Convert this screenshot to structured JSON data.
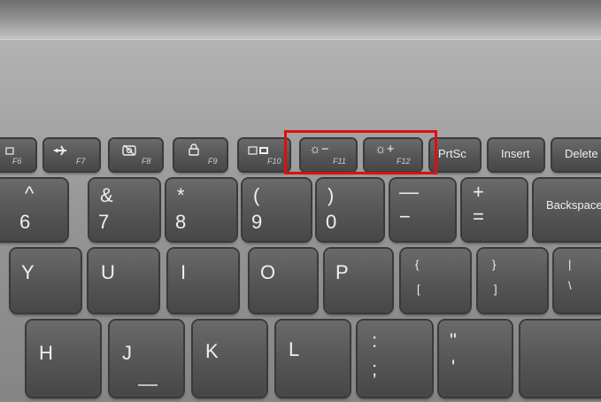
{
  "function_row": {
    "f6": {
      "fn": "F6",
      "icon": "display-icon"
    },
    "f7": {
      "fn": "F7",
      "icon": "airplane-icon"
    },
    "f8": {
      "fn": "F8",
      "icon": "camera-off-icon"
    },
    "f9": {
      "fn": "F9",
      "icon": "lock-icon"
    },
    "f10": {
      "fn": "F10",
      "icon": "dual-display-icon"
    },
    "f11": {
      "fn": "F11",
      "symbol": "☼−",
      "icon": "brightness-down-icon"
    },
    "f12": {
      "fn": "F12",
      "symbol": "☼+",
      "icon": "brightness-up-icon"
    },
    "prtsc": "PrtSc",
    "insert": "Insert",
    "delete": "Delete"
  },
  "number_row": [
    {
      "top": "^",
      "bottom": "6"
    },
    {
      "top": "&",
      "bottom": "7"
    },
    {
      "top": "*",
      "bottom": "8"
    },
    {
      "top": "(",
      "bottom": "9"
    },
    {
      "top": ")",
      "bottom": "0"
    },
    {
      "top": "—",
      "bottom": "−"
    },
    {
      "top": "+",
      "bottom": "="
    },
    {
      "label": "Backspace"
    }
  ],
  "qwerty_row": [
    {
      "label": "Y"
    },
    {
      "label": "U"
    },
    {
      "label": "I"
    },
    {
      "label": "O"
    },
    {
      "label": "P"
    },
    {
      "top": "{",
      "bottom": "["
    },
    {
      "top": "}",
      "bottom": "]"
    },
    {
      "top": "|",
      "bottom": "\\"
    }
  ],
  "home_row": [
    {
      "label": "H"
    },
    {
      "label": "J"
    },
    {
      "label": "K"
    },
    {
      "label": "L"
    },
    {
      "top": ":",
      "bottom": ";"
    },
    {
      "top": "\"",
      "bottom": "'"
    }
  ],
  "highlight_color": "#e30d0d"
}
